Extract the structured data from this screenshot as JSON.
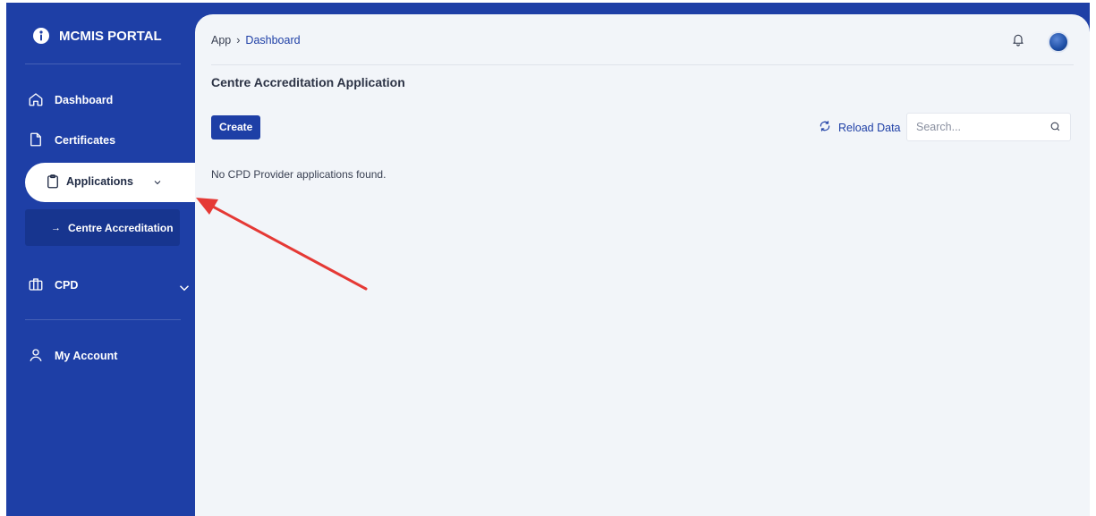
{
  "brand": {
    "name": "MCMIS PORTAL"
  },
  "sidebar": {
    "items": [
      {
        "label": "Dashboard",
        "icon": "home-icon"
      },
      {
        "label": "Certificates",
        "icon": "file-icon"
      },
      {
        "label": "Applications",
        "icon": "clipboard-icon",
        "active": true
      },
      {
        "label": "CPD",
        "icon": "briefcase-icon"
      },
      {
        "label": "My Account",
        "icon": "user-icon"
      }
    ],
    "subitem": {
      "label": "Centre Accreditation",
      "prefix": "→"
    }
  },
  "breadcrumb": {
    "root": "App",
    "separator": "›",
    "current": "Dashboard"
  },
  "page": {
    "title": "Centre Accreditation Application",
    "create_label": "Create",
    "reload_label": "Reload Data",
    "search_placeholder": "Search...",
    "empty_message": "No CPD Provider applications found."
  },
  "colors": {
    "brand_blue": "#1e3fa6",
    "panel_bg": "#f2f5f9",
    "annotation_red": "#e53935"
  }
}
